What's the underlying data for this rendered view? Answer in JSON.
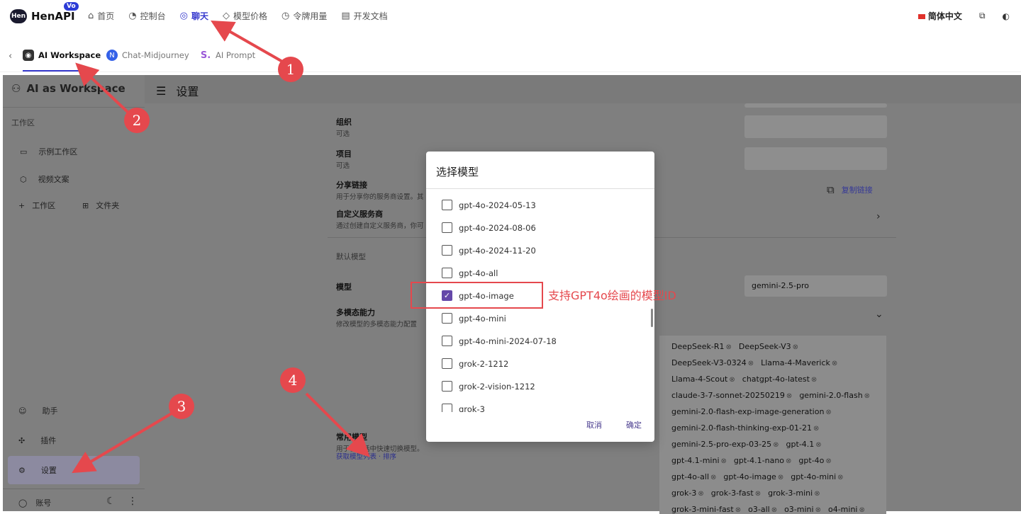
{
  "topbar": {
    "logo_badge": "Hen",
    "logo_name": "HenAPI",
    "logo_superscript": "Vo",
    "nav": [
      {
        "icon": "⌂",
        "label": "首页"
      },
      {
        "icon": "◔",
        "label": "控制台"
      },
      {
        "icon": "◎",
        "label": "聊天"
      },
      {
        "icon": "◇",
        "label": "模型价格"
      },
      {
        "icon": "◷",
        "label": "令牌用量"
      },
      {
        "icon": "▤",
        "label": "开发文档"
      }
    ],
    "language": "简体中文"
  },
  "tabs": {
    "back_icon": "‹",
    "items": [
      {
        "label": "AI Workspace",
        "icon": "◉"
      },
      {
        "label": "Chat-Midjourney",
        "icon": "N"
      },
      {
        "label": "AI Prompt",
        "icon": "S."
      }
    ]
  },
  "sidebar": {
    "title": "AI as Workspace",
    "section": "工作区",
    "items": [
      {
        "icon": "▭",
        "label": "示例工作区"
      },
      {
        "icon": "⬡",
        "label": "视频文案"
      }
    ],
    "add_workspace": "工作区",
    "add_folder": "文件夹",
    "bottom_items": [
      {
        "icon": "☺",
        "label": "助手"
      },
      {
        "icon": "✣",
        "label": "插件"
      },
      {
        "icon": "⚙",
        "label": "设置"
      }
    ],
    "account": "账号"
  },
  "main": {
    "title": "设置",
    "rows": {
      "org": {
        "label": "组织",
        "sub": "可选"
      },
      "project": {
        "label": "项目",
        "sub": "可选"
      },
      "share": {
        "label": "分享链接",
        "sub": "用于分享你的服务商设置。其",
        "action": "复制链接"
      },
      "custom": {
        "label": "自定义服务商",
        "sub": "通过创建自定义服务商，你可"
      },
      "default_section": "默认模型",
      "model": {
        "label": "模型",
        "value": "gemini-2.5-pro"
      },
      "multimodal": {
        "label": "多模态能力",
        "sub": "修改模型的多模态能力配置"
      },
      "common": {
        "label": "常用模型",
        "sub": "用于在对话中快速切换模型。",
        "link": "获取模型列表 · 排序"
      }
    },
    "chips": [
      [
        "DeepSeek-R1",
        "DeepSeek-V3"
      ],
      [
        "DeepSeek-V3-0324",
        "Llama-4-Maverick"
      ],
      [
        "Llama-4-Scout",
        "chatgpt-4o-latest"
      ],
      [
        "claude-3-7-sonnet-20250219",
        "gemini-2.0-flash"
      ],
      [
        "gemini-2.0-flash-exp-image-generation"
      ],
      [
        "gemini-2.0-flash-thinking-exp-01-21"
      ],
      [
        "gemini-2.5-pro-exp-03-25",
        "gpt-4.1"
      ],
      [
        "gpt-4.1-mini",
        "gpt-4.1-nano",
        "gpt-4o"
      ],
      [
        "gpt-4o-all",
        "gpt-4o-image",
        "gpt-4o-mini"
      ],
      [
        "grok-3",
        "grok-3-fast",
        "grok-3-mini"
      ],
      [
        "grok-3-mini-fast",
        "o3-all",
        "o3-mini",
        "o4-mini"
      ]
    ]
  },
  "dialog": {
    "title": "选择模型",
    "options": [
      {
        "label": "gpt-4o-2024-05-13",
        "checked": false
      },
      {
        "label": "gpt-4o-2024-08-06",
        "checked": false
      },
      {
        "label": "gpt-4o-2024-11-20",
        "checked": false
      },
      {
        "label": "gpt-4o-all",
        "checked": false
      },
      {
        "label": "gpt-4o-image",
        "checked": true
      },
      {
        "label": "gpt-4o-mini",
        "checked": false
      },
      {
        "label": "gpt-4o-mini-2024-07-18",
        "checked": false
      },
      {
        "label": "grok-2-1212",
        "checked": false
      },
      {
        "label": "grok-2-vision-1212",
        "checked": false
      },
      {
        "label": "grok-3",
        "checked": false
      }
    ],
    "cancel": "取消",
    "confirm": "确定"
  },
  "annotations": {
    "callout": "支持GPT4o绘画的模型ID",
    "badges": [
      "1",
      "2",
      "3",
      "4"
    ],
    "color": "#e5484d"
  }
}
